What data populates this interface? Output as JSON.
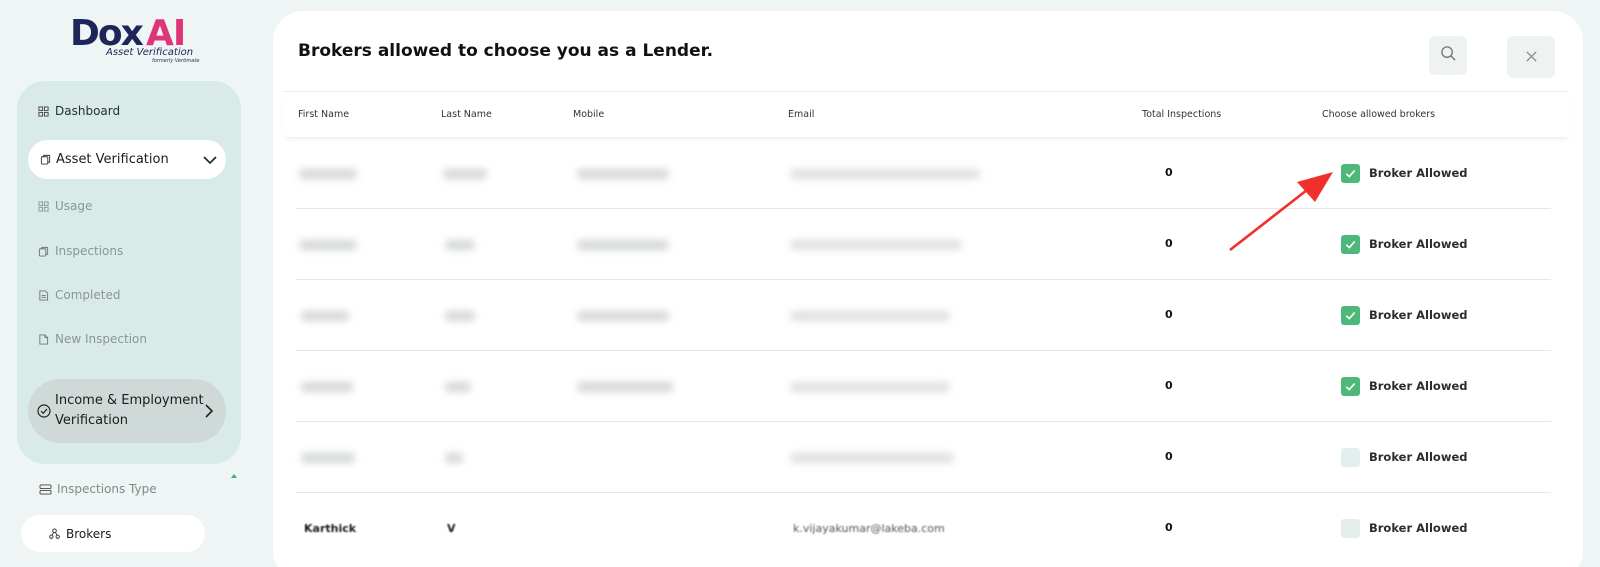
{
  "brand": {
    "name": "Dox",
    "suffix": "AI",
    "tagline": "Asset Verification",
    "formerly": "formerly Vertimate"
  },
  "sidebar": {
    "items": [
      {
        "label": "Dashboard",
        "icon": "grid-icon"
      },
      {
        "label": "Asset Verification",
        "icon": "layers-icon"
      },
      {
        "label": "Usage",
        "icon": "grid-icon"
      },
      {
        "label": "Inspections",
        "icon": "layers-icon"
      },
      {
        "label": "Completed",
        "icon": "document-icon"
      },
      {
        "label": "New Inspection",
        "icon": "file-icon"
      },
      {
        "label": "Income & Employment Verification",
        "icon": "check-circle-icon"
      }
    ],
    "extra": [
      {
        "label": "Inspections Type",
        "icon": "server-icon"
      },
      {
        "label": "Brokers",
        "icon": "network-icon"
      }
    ]
  },
  "main": {
    "title": "Brokers allowed to choose you as a Lender.",
    "columns": [
      "First Name",
      "Last Name",
      "Mobile",
      "Email",
      "Total Inspections",
      "Choose allowed brokers"
    ],
    "rows": [
      {
        "first_name": "",
        "last_name": "",
        "mobile": "",
        "email": "",
        "total": "0",
        "allowed": true,
        "allow_label": "Broker Allowed"
      },
      {
        "first_name": "",
        "last_name": "",
        "mobile": "",
        "email": "",
        "total": "0",
        "allowed": true,
        "allow_label": "Broker Allowed"
      },
      {
        "first_name": "",
        "last_name": "",
        "mobile": "",
        "email": "",
        "total": "0",
        "allowed": true,
        "allow_label": "Broker Allowed"
      },
      {
        "first_name": "",
        "last_name": "",
        "mobile": "",
        "email": "",
        "total": "0",
        "allowed": true,
        "allow_label": "Broker Allowed"
      },
      {
        "first_name": "",
        "last_name": "",
        "mobile": "",
        "email": "",
        "total": "0",
        "allowed": false,
        "allow_label": "Broker Allowed"
      },
      {
        "first_name": "Karthick",
        "last_name": "V",
        "mobile": "",
        "email": "k.vijayakumar@lakeba.com",
        "total": "0",
        "allowed": false,
        "allow_label": "Broker Allowed"
      }
    ]
  },
  "colors": {
    "accent": "#4db87a",
    "sidebar_bg": "#d9ebe8",
    "page_bg": "#eef5f4",
    "annotation_arrow": "#f0302c"
  }
}
